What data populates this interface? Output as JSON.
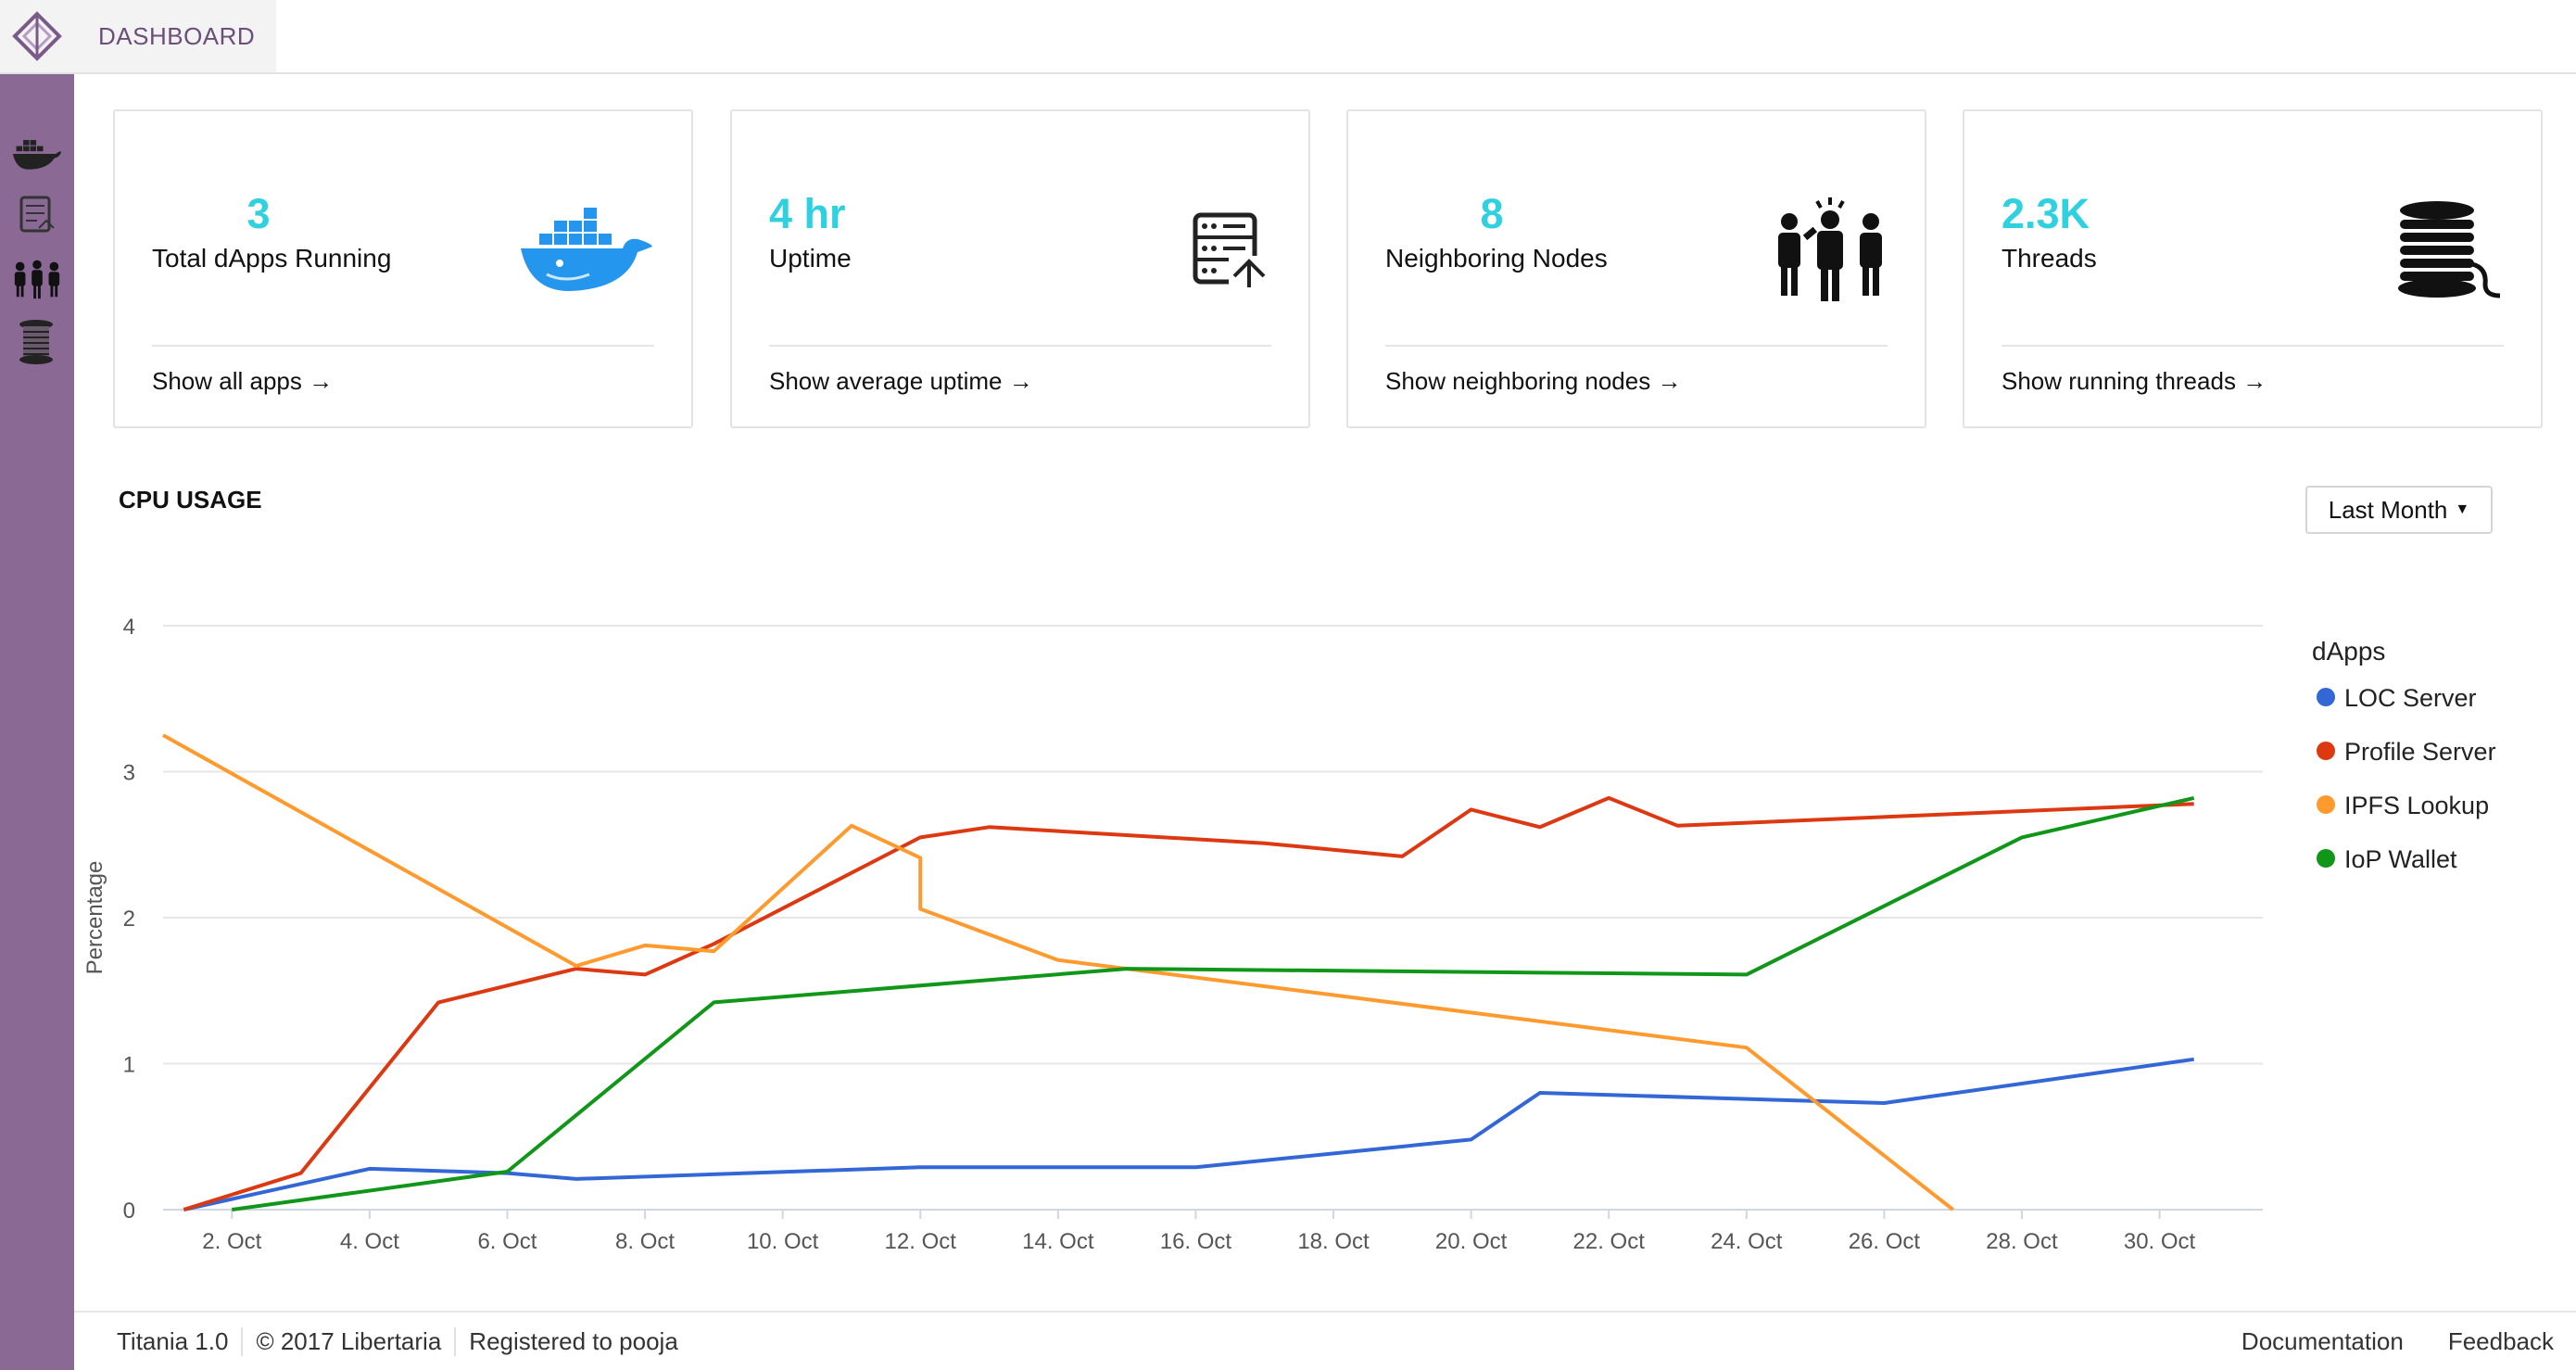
{
  "header": {
    "title": "DASHBOARD"
  },
  "sidebar": {
    "items": [
      {
        "name": "docker-ship-icon"
      },
      {
        "name": "server-report-icon"
      },
      {
        "name": "people-nodes-icon"
      },
      {
        "name": "thread-spool-icon"
      }
    ]
  },
  "cards": [
    {
      "value": "3",
      "label": "Total dApps Running",
      "link": "Show all apps →",
      "icon": "docker-whale-icon"
    },
    {
      "value": "4 hr",
      "label": "Uptime",
      "link": "Show average uptime →",
      "icon": "server-upload-icon"
    },
    {
      "value": "8",
      "label": "Neighboring Nodes",
      "link": "Show neighboring nodes →",
      "icon": "people-group-icon"
    },
    {
      "value": "2.3K",
      "label": "Threads",
      "link": "Show running threads →",
      "icon": "thread-spool-icon"
    }
  ],
  "cpu": {
    "title": "CPU USAGE",
    "range": "Last Month"
  },
  "colors": {
    "accent": "#2fd1e0",
    "sidebar": "#8a6a95",
    "loc": "#3367d6",
    "profile": "#dc3912",
    "ipfs": "#ff9a2e",
    "iop": "#109618"
  },
  "chart_data": {
    "type": "line",
    "ylabel": "Percentage",
    "xlabel": "",
    "ylim": [
      0,
      4
    ],
    "yticks": [
      0,
      1,
      2,
      3,
      4
    ],
    "xlim": [
      1,
      31.5
    ],
    "xticks": [
      2,
      4,
      6,
      8,
      10,
      12,
      14,
      16,
      18,
      20,
      22,
      24,
      26,
      28,
      30
    ],
    "xtick_labels": [
      "2. Oct",
      "4. Oct",
      "6. Oct",
      "8. Oct",
      "10. Oct",
      "12. Oct",
      "14. Oct",
      "16. Oct",
      "18. Oct",
      "20. Oct",
      "22. Oct",
      "24. Oct",
      "26. Oct",
      "28. Oct",
      "30. Oct"
    ],
    "legend": {
      "title": "dApps",
      "position": "right"
    },
    "series": [
      {
        "name": "LOC Server",
        "color": "#3367d6",
        "x": [
          1.3,
          4,
          6,
          7,
          12,
          16,
          20,
          21,
          26,
          30.5
        ],
        "y": [
          0,
          0.28,
          0.25,
          0.21,
          0.29,
          0.29,
          0.48,
          0.8,
          0.73,
          1.03
        ]
      },
      {
        "name": "Profile Server",
        "color": "#dc3912",
        "x": [
          1.3,
          3,
          5,
          7,
          8,
          9,
          12,
          13,
          17,
          19,
          20,
          21,
          22,
          23,
          30.5
        ],
        "y": [
          0,
          0.25,
          1.42,
          1.65,
          1.61,
          1.82,
          2.55,
          2.62,
          2.51,
          2.42,
          2.74,
          2.62,
          2.82,
          2.63,
          2.78
        ]
      },
      {
        "name": "IPFS Lookup",
        "color": "#ff9a2e",
        "x": [
          1.0,
          7,
          8,
          9,
          11,
          12,
          12,
          14,
          24,
          27
        ],
        "y": [
          3.25,
          1.67,
          1.81,
          1.77,
          2.63,
          2.41,
          2.06,
          1.71,
          1.11,
          0
        ]
      },
      {
        "name": "IoP Wallet",
        "color": "#109618",
        "x": [
          2,
          6,
          9,
          15,
          24,
          28,
          30.5
        ],
        "y": [
          0,
          0.26,
          1.42,
          1.65,
          1.61,
          2.55,
          2.82
        ]
      }
    ]
  },
  "footer": {
    "version": "Titania 1.0",
    "copyright": "©  2017 Libertaria",
    "registered": "Registered to pooja",
    "links": [
      "Documentation",
      "Feedback"
    ]
  }
}
